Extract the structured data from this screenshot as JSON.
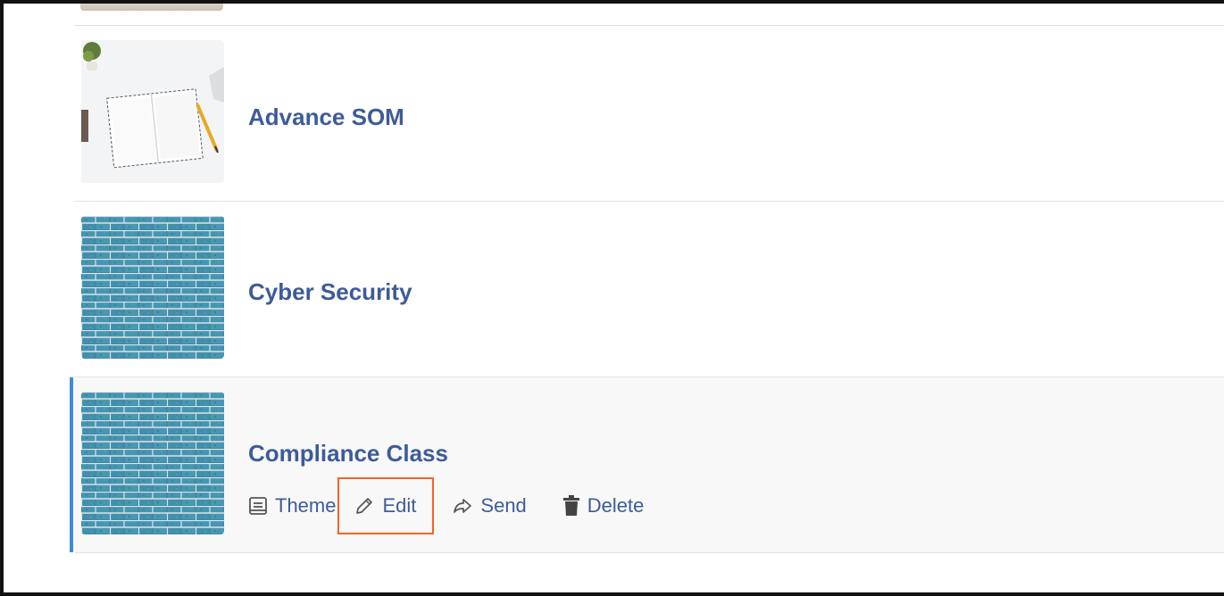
{
  "items": [
    {
      "title": "Advance SOM",
      "thumbnail": "notebook-desk-photo"
    },
    {
      "title": "Cyber Security",
      "thumbnail": "blue-brick-wall"
    },
    {
      "title": "Compliance Class",
      "thumbnail": "blue-brick-wall",
      "selected": true
    }
  ],
  "actions": {
    "theme": "Theme",
    "edit": "Edit",
    "send": "Send",
    "delete": "Delete"
  },
  "colors": {
    "title": "#3e5b99",
    "selected_accent": "#3d8bd9",
    "highlight_box": "#f26522"
  }
}
